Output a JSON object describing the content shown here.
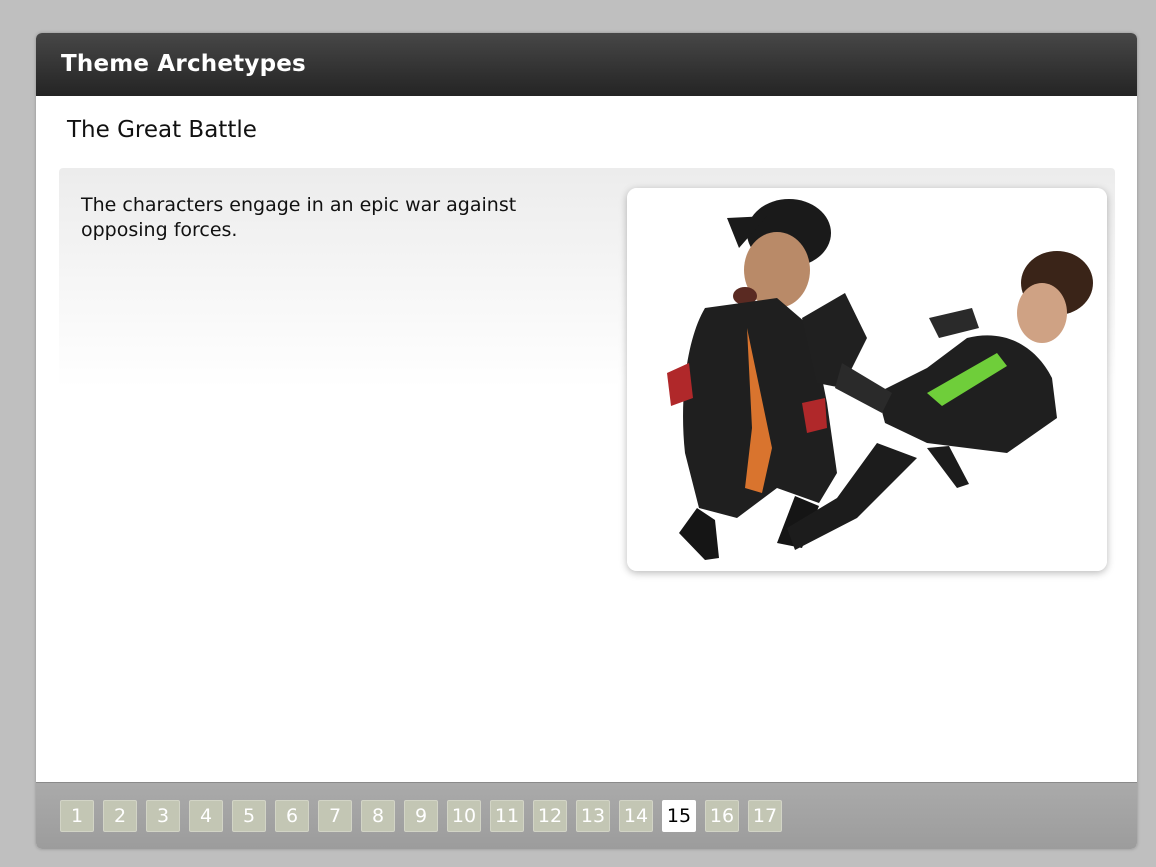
{
  "header": {
    "title": "Theme Archetypes"
  },
  "slide": {
    "title": "The Great Battle",
    "body": "The characters engage in an epic war against opposing forces.",
    "image_icon": "photo-two-men-fighting"
  },
  "pagination": {
    "pages": [
      "1",
      "2",
      "3",
      "4",
      "5",
      "6",
      "7",
      "8",
      "9",
      "10",
      "11",
      "12",
      "13",
      "14",
      "15",
      "16",
      "17"
    ],
    "current": "15"
  },
  "colors": {
    "header_bg": "#2f2f2f",
    "footer_bg": "#a3a3a3",
    "page_button": "#c3c6b4",
    "page_button_active": "#ffffff"
  }
}
